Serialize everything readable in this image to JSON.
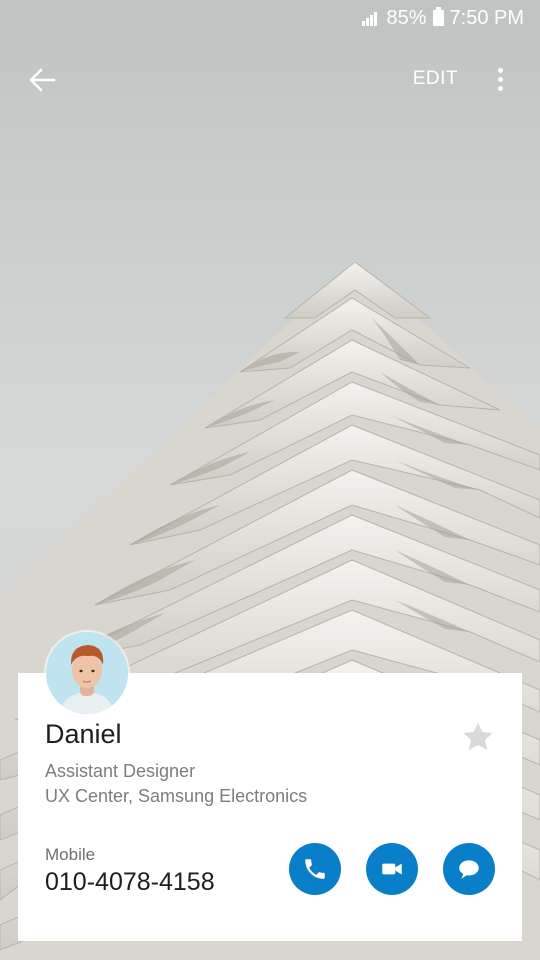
{
  "status_bar": {
    "battery_percent": "85%",
    "time": "7:50 PM"
  },
  "action_bar": {
    "edit_label": "EDIT"
  },
  "contact": {
    "name": "Daniel",
    "job_title": "Assistant Designer",
    "organization": "UX Center, Samsung Electronics",
    "phone_type": "Mobile",
    "phone_number": "010-4078-4158",
    "favorite": false
  },
  "colors": {
    "accent": "#0a7fc9",
    "star_inactive": "#d9d9d9"
  },
  "icons": {
    "back": "arrow-left-icon",
    "more": "more-vert-icon",
    "star": "star-icon",
    "call": "phone-icon",
    "video": "video-icon",
    "message": "message-icon"
  }
}
